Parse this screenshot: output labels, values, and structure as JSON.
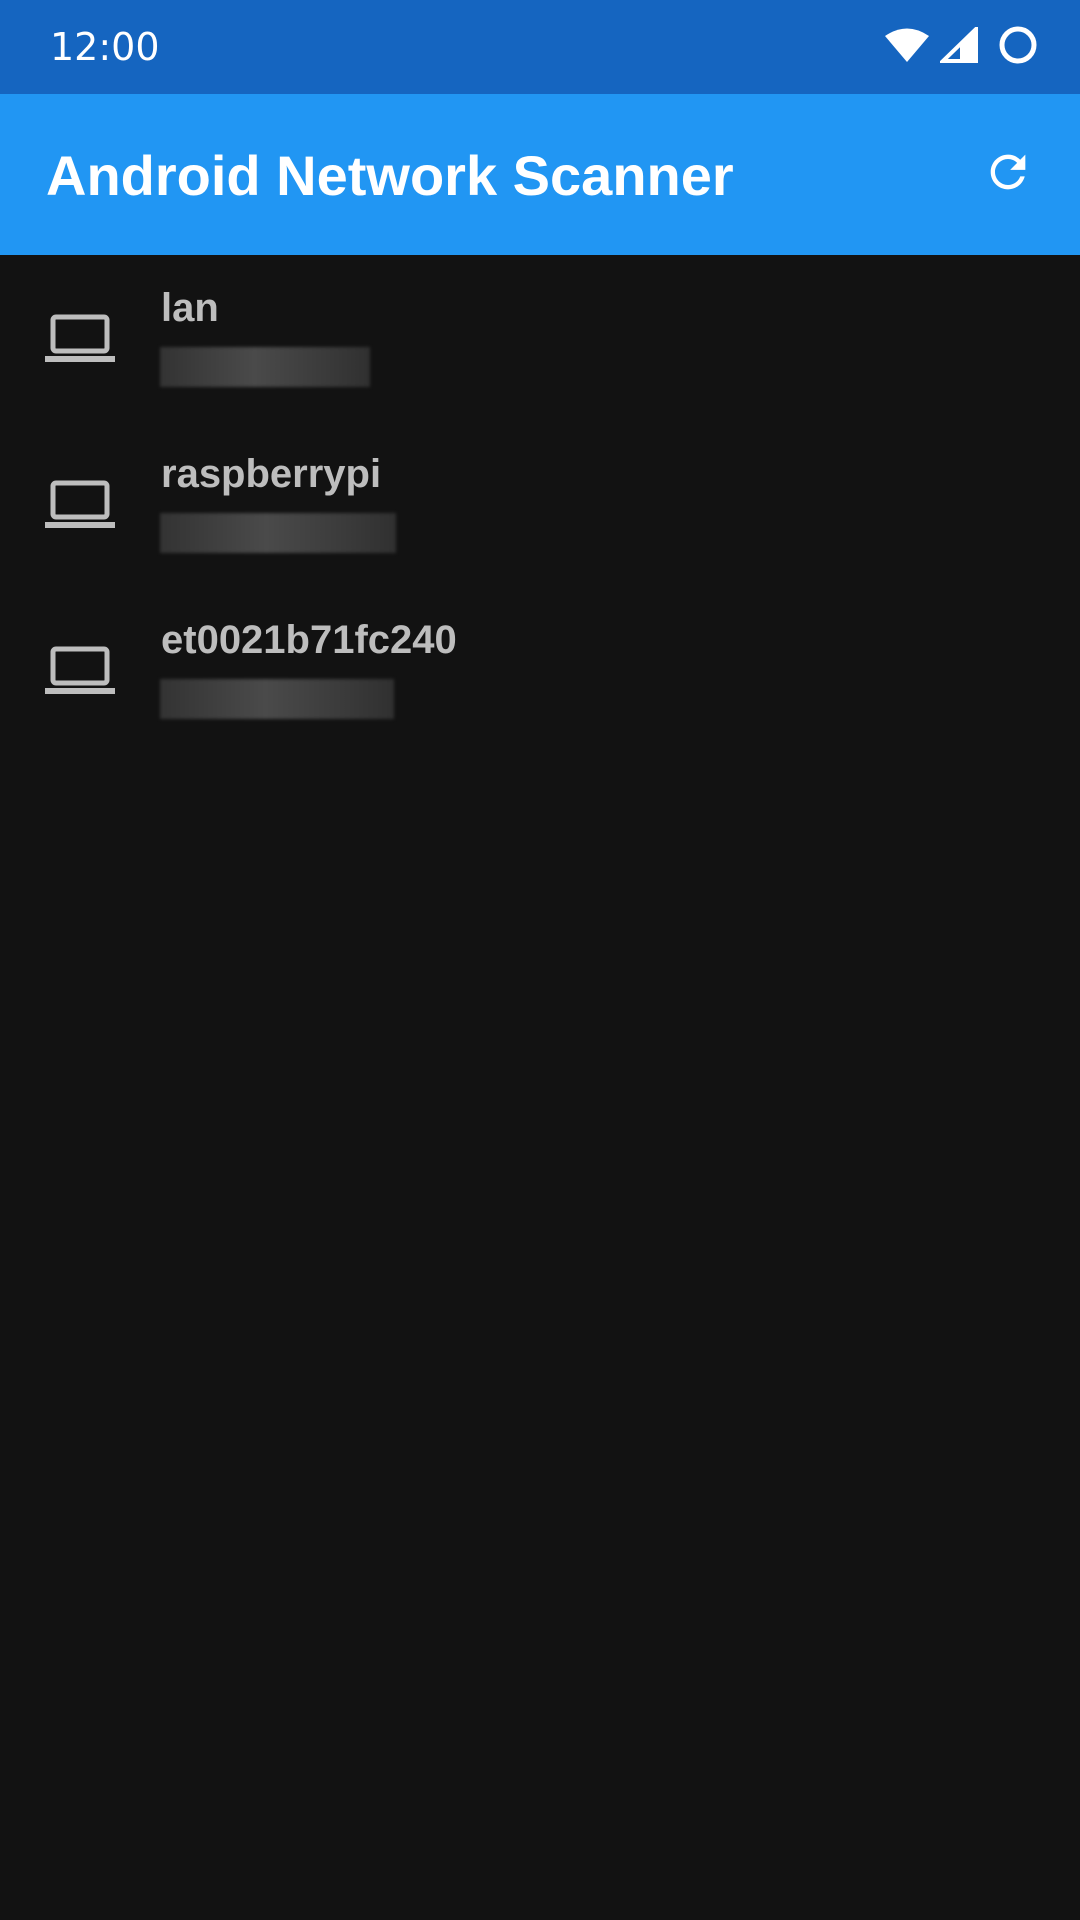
{
  "status_bar": {
    "time": "12:00",
    "icons": [
      "wifi-icon",
      "signal-icon",
      "battery-icon"
    ]
  },
  "app_bar": {
    "title": "Android Network Scanner",
    "refresh_icon": "refresh-icon",
    "background": "#2196F3"
  },
  "colors": {
    "status_bar": "#1565C0",
    "background": "#121212",
    "text_secondary": "#bdbdbd"
  },
  "devices": [
    {
      "name": "lan",
      "icon": "laptop-icon"
    },
    {
      "name": "raspberrypi",
      "icon": "laptop-icon"
    },
    {
      "name": "et0021b71fc240",
      "icon": "laptop-icon"
    }
  ]
}
